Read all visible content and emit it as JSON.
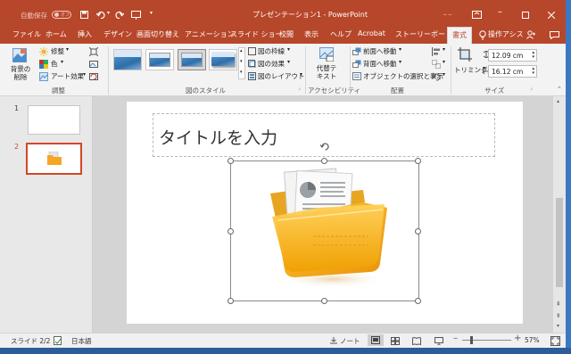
{
  "titlebar": {
    "autosave_label": "自動保存",
    "autosave_state": "オフ",
    "doc_title": "プレゼンテーション1 - PowerPoint",
    "tools_label": "描画ツール",
    "accent": "#b7472a"
  },
  "tabs": {
    "items": [
      "ファイル",
      "ホーム",
      "挿入",
      "デザイン",
      "画面切り替え",
      "アニメーション",
      "スライド ショー",
      "校閲",
      "表示",
      "ヘルプ",
      "Acrobat",
      "ストーリーボード",
      "書式"
    ],
    "active": "書式",
    "tell_me": "操作アシス"
  },
  "ribbon": {
    "remove_bg": "背景の\n削除",
    "corrections": "修整",
    "color": "色",
    "artistic": "アート効果",
    "group_adjust": "調整",
    "picture_border": "図の枠線",
    "picture_effects": "図の効果",
    "picture_layout": "図のレイアウト",
    "group_styles": "図のスタイル",
    "alt_text": "代替テ\nキスト",
    "group_access": "アクセシビリティ",
    "bring_forward": "前面へ移動",
    "send_backward": "背面へ移動",
    "selection_pane": "オブジェクトの選択と表示",
    "group_arrange": "配置",
    "crop": "トリミング",
    "height": "12.09 cm",
    "width": "16.12 cm",
    "group_size": "サイズ"
  },
  "slides": {
    "items": [
      {
        "num": "1"
      },
      {
        "num": "2"
      }
    ],
    "selected": "2"
  },
  "slide": {
    "title_placeholder": "タイトルを入力"
  },
  "status": {
    "slide_info": "スライド 2/2",
    "language": "日本語",
    "notes": "ノート",
    "zoom": "57%"
  }
}
